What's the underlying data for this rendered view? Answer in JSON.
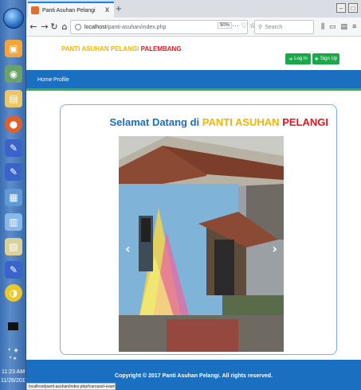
{
  "browser": {
    "tab_title": "Panti Asuhan Pelangi",
    "tab_close": "x",
    "new_tab": "+",
    "url_host": "localhost",
    "url_path": "/panti-asuhan/index.php",
    "zoom": "90%",
    "search_placeholder": "Search",
    "page_actions": "··· ♡ ☆",
    "status_url": "localhost/panti-asuhan/index.php#carousel-example-generic"
  },
  "site": {
    "brand_part1": "PANTI ASUHAN PELANGI",
    "brand_part2": "PALEMBANG",
    "login_label": "Log In",
    "signup_label": "Sign Up",
    "menu": [
      "Home",
      "Profile"
    ],
    "welcome_prefix": "Selamat Datang di",
    "welcome_highlight1": "PANTI ASUHAN",
    "welcome_highlight2": "PELANGI",
    "footer": "Copyright © 2017 Panti Asuhan Pelangi. All rights reserved."
  },
  "taskbar": {
    "time": "11:23 AM",
    "date": "11/26/2017"
  },
  "colors": {
    "primary_blue": "#1b6fc1",
    "accent_yellow": "#f7b500",
    "accent_red": "#e8151f",
    "green": "#1aa84a"
  }
}
